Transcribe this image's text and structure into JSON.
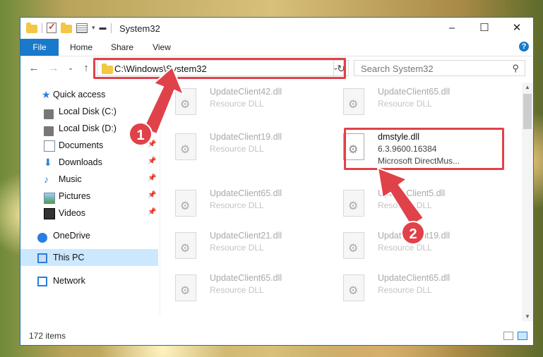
{
  "window": {
    "title": "System32",
    "minimize": "–",
    "maximize": "☐",
    "close": "✕"
  },
  "ribbon": {
    "tabs": [
      "File",
      "Home",
      "Share",
      "View"
    ],
    "help": "?"
  },
  "address": {
    "path": "C:\\Windows\\System32",
    "search_placeholder": "Search System32"
  },
  "sidebar": {
    "items": [
      {
        "label": "Quick access",
        "icon": "star-icon"
      },
      {
        "label": "Local Disk (C:)",
        "icon": "disk-icon"
      },
      {
        "label": "Local Disk (D:)",
        "icon": "disk-icon"
      },
      {
        "label": "Documents",
        "icon": "document-icon"
      },
      {
        "label": "Downloads",
        "icon": "download-icon"
      },
      {
        "label": "Music",
        "icon": "music-icon"
      },
      {
        "label": "Pictures",
        "icon": "pictures-icon"
      },
      {
        "label": "Videos",
        "icon": "videos-icon"
      },
      {
        "label": "OneDrive",
        "icon": "cloud-icon"
      },
      {
        "label": "This PC",
        "icon": "computer-icon"
      },
      {
        "label": "Network",
        "icon": "network-icon"
      }
    ]
  },
  "files": [
    {
      "name": "UpdateClient42.dll",
      "desc": "Resource DLL"
    },
    {
      "name": "UpdateClient65.dll",
      "desc": "Resource DLL"
    },
    {
      "name": "UpdateClient19.dll",
      "desc": "Resource DLL"
    },
    {
      "name": "dmstyle.dll",
      "desc": "6.3.9600.16384",
      "desc2": "Microsoft DirectMus..."
    },
    {
      "name": "UpdateClient65.dll",
      "desc": "Resource DLL"
    },
    {
      "name": "UpdateClient5.dll",
      "desc": "Resource DLL"
    },
    {
      "name": "UpdateClient21.dll",
      "desc": "Resource DLL"
    },
    {
      "name": "UpdateClient19.dll",
      "desc": "Resource DLL"
    },
    {
      "name": "UpdateClient65.dll",
      "desc": "Resource DLL"
    },
    {
      "name": "UpdateClient65.dll",
      "desc": "Resource DLL"
    }
  ],
  "status": {
    "item_count": "172 items"
  },
  "annotations": {
    "step1": "1",
    "step2": "2"
  },
  "colors": {
    "accent": "#1979ca",
    "highlight": "#e0424a",
    "selected": "#cce8ff"
  }
}
